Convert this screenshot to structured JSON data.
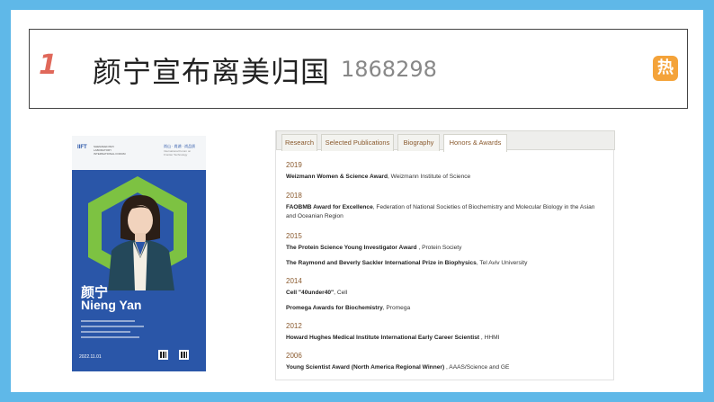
{
  "search": {
    "rank": "1",
    "topic": "颜宁宣布离美归国",
    "count": "1868298",
    "badge": "热"
  },
  "poster": {
    "logo": "IIFT",
    "logo_sub": "SHENZHEN BAY LABORATORY INTERNATIONAL FORUM",
    "tag": "尚山 · 尚湖 · 尚品质",
    "tag_sub": "International Forum on Frontier Technology",
    "name_cn": "颜宁",
    "name_en": "Nieng Yan",
    "date": "2022.11.01",
    "colors": {
      "accent_green": "#7dc242",
      "blue": "#2a56a8"
    }
  },
  "honors": {
    "tabs": [
      {
        "label": "Research"
      },
      {
        "label": "Selected Publications"
      },
      {
        "label": "Biography"
      },
      {
        "label": "Honors & Awards"
      }
    ],
    "active_tab": "Honors & Awards",
    "entries": [
      {
        "year": "2019",
        "awards": [
          {
            "name": "Weizmann Women & Science Award",
            "org": ", Weizmann Institute of Science"
          }
        ]
      },
      {
        "year": "2018",
        "awards": [
          {
            "name": "FAOBMB Award for Excellence",
            "org": ", Federation of National Societies of Biochemistry and Molecular Biology in the Asian and Oceanian Region"
          }
        ]
      },
      {
        "year": "2015",
        "awards": [
          {
            "name": "The Protein Science Young Investigator Award",
            "org": " , Protein Society"
          },
          {
            "name": "The Raymond and Beverly Sackler International Prize in Biophysics",
            "org": ", Tel Aviv University"
          }
        ]
      },
      {
        "year": "2014",
        "awards": [
          {
            "name": "Cell \"40under40\"",
            "org": ", Cell"
          },
          {
            "name": "Promega Awards for Biochemistry",
            "org": ", Promega"
          }
        ]
      },
      {
        "year": "2012",
        "awards": [
          {
            "name": "Howard Hughes Medical Institute International Early Career Scientist",
            "org": " , HHMI"
          }
        ]
      },
      {
        "year": "2006",
        "awards": [
          {
            "name": "Young Scientist Award (North America Regional Winner)",
            "org": " , AAAS/Science and GE"
          }
        ]
      }
    ]
  }
}
